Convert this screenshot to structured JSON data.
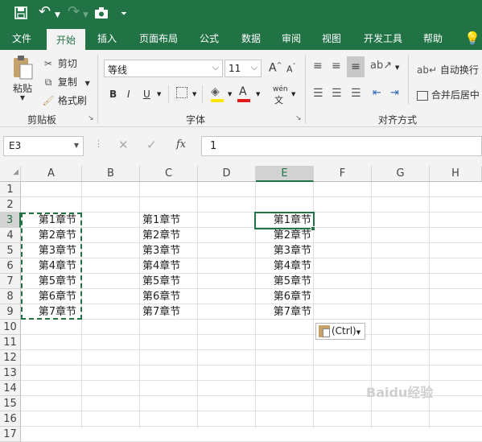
{
  "qat": {
    "save_icon": "save-icon",
    "undo_icon": "undo-icon",
    "redo_icon": "redo-icon",
    "camera_icon": "camera-icon",
    "more_icon": "customize-icon"
  },
  "tabs": [
    "文件",
    "开始",
    "插入",
    "页面布局",
    "公式",
    "数据",
    "审阅",
    "视图",
    "开发工具",
    "帮助"
  ],
  "clipboard": {
    "paste": "粘贴",
    "cut": "剪切",
    "copy": "复制",
    "format_painter": "格式刷",
    "group": "剪贴板"
  },
  "font": {
    "name": "等线",
    "size": "11",
    "group": "字体",
    "bold": "B",
    "italic": "I",
    "underline": "U",
    "grow": "A",
    "shrink": "A",
    "color_a": "A",
    "phonetic": "wén"
  },
  "alignment": {
    "wrap": "自动换行",
    "merge": "合并后居中",
    "group": "对齐方式"
  },
  "formula_bar": {
    "name_box": "E3",
    "fx": "fx",
    "value": "1"
  },
  "columns": [
    "A",
    "B",
    "C",
    "D",
    "E",
    "F",
    "G",
    "H"
  ],
  "rows": [
    "1",
    "2",
    "3",
    "4",
    "5",
    "6",
    "7",
    "8",
    "9",
    "10",
    "11",
    "12",
    "13",
    "14",
    "15",
    "16",
    "17"
  ],
  "col_a": [
    "第1章节",
    "第2章节",
    "第3章节",
    "第4章节",
    "第5章节",
    "第6章节",
    "第7章节"
  ],
  "col_c": [
    "第1章节",
    "第2章节",
    "第3章节",
    "第4章节",
    "第5章节",
    "第6章节",
    "第7章节"
  ],
  "col_e": [
    "第1章节",
    "第2章节",
    "第3章节",
    "第4章节",
    "第5章节",
    "第6章节",
    "第7章节"
  ],
  "paste_options": "(Ctrl)",
  "watermark": "Baidu经验",
  "colors": {
    "excel_green": "#217346",
    "font_color_red": "#e41a1a",
    "highlight_yellow": "#ffe600"
  }
}
